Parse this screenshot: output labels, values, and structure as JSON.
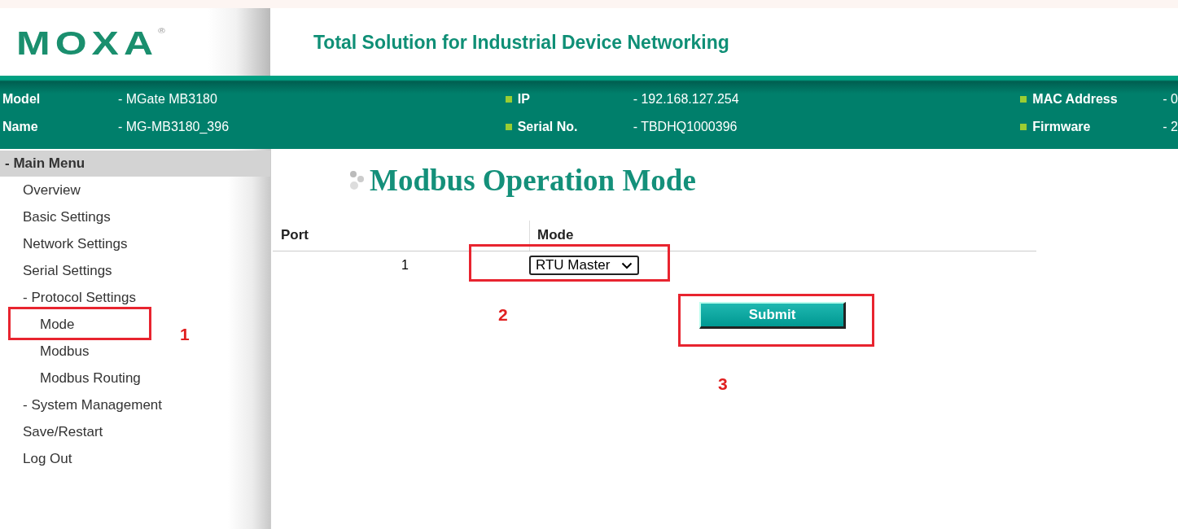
{
  "logo": {
    "text": "MOXA",
    "mark": "®"
  },
  "header": {
    "title": "Total Solution for Industrial Device Networking"
  },
  "info_bar": {
    "columns": [
      [
        {
          "label": "Model",
          "value": "- MGate MB3180",
          "bullet": false
        },
        {
          "label": "Name",
          "value": "- MG-MB3180_396",
          "bullet": false
        }
      ],
      [
        {
          "label": "IP",
          "value": "- 192.168.127.254",
          "bullet": true
        },
        {
          "label": "Serial No.",
          "value": "- TBDHQ1000396",
          "bullet": true
        }
      ],
      [
        {
          "label": "MAC Address",
          "value": "- 0",
          "bullet": true
        },
        {
          "label": "Firmware",
          "value": "- 2",
          "bullet": true
        }
      ]
    ]
  },
  "sidebar": {
    "title": "- Main Menu",
    "items": [
      {
        "label": "Overview"
      },
      {
        "label": "Basic Settings"
      },
      {
        "label": "Network Settings"
      },
      {
        "label": "Serial Settings"
      },
      {
        "label": "- Protocol Settings",
        "children": [
          {
            "label": "Mode"
          },
          {
            "label": "Modbus"
          },
          {
            "label": "Modbus Routing"
          }
        ]
      },
      {
        "label": "- System Management"
      },
      {
        "label": "Save/Restart"
      },
      {
        "label": "Log Out"
      }
    ]
  },
  "page": {
    "title": "Modbus Operation Mode",
    "table": {
      "columns": [
        "Port",
        "Mode"
      ],
      "rows": [
        {
          "port": "1",
          "mode": "RTU Master"
        }
      ]
    },
    "submit": "Submit"
  },
  "annotations": [
    {
      "label": "1"
    },
    {
      "label": "2"
    },
    {
      "label": "3"
    }
  ]
}
